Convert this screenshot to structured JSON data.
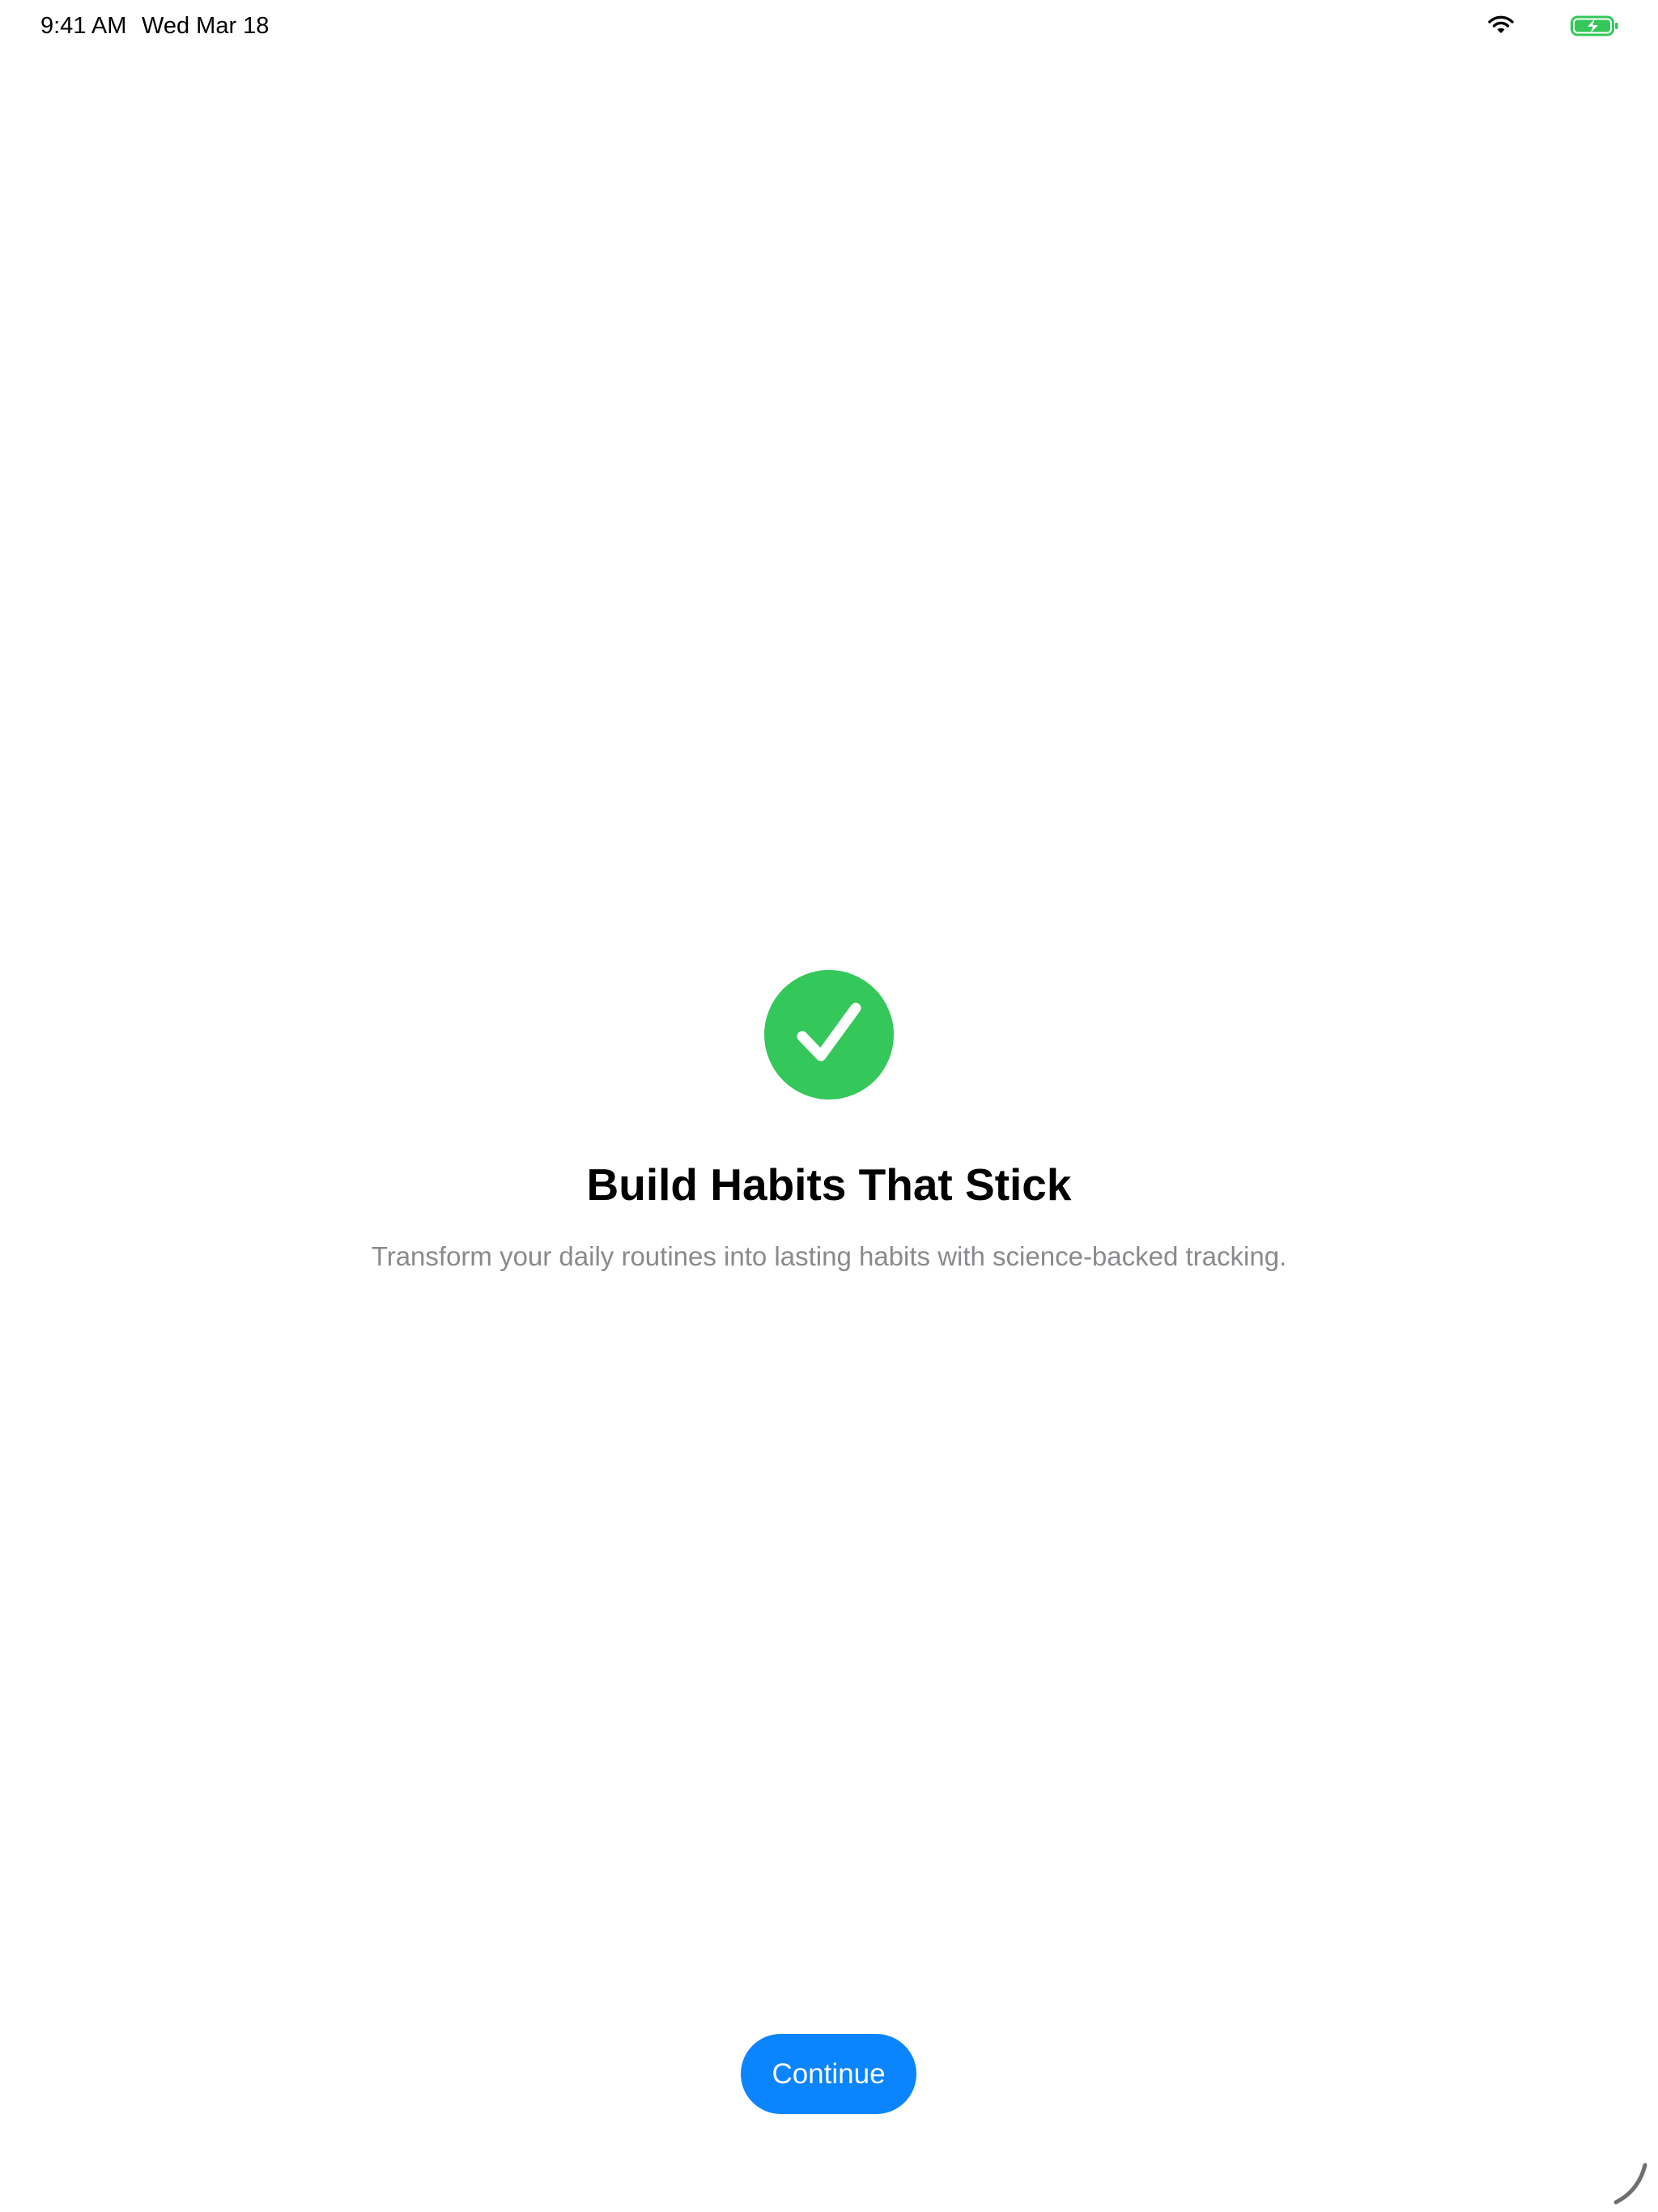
{
  "status_bar": {
    "time": "9:41 AM",
    "date": "Wed Mar 18",
    "wifi_icon": "wifi-icon",
    "battery_icon": "battery-charging-icon",
    "battery_color": "#34c759"
  },
  "onboarding": {
    "hero_icon": "checkmark-circle-icon",
    "hero_color": "#34c759",
    "title": "Build Habits That Stick",
    "subtitle": "Transform your daily routines into lasting habits with science-backed tracking.",
    "continue_label": "Continue",
    "accent_color": "#0a84ff"
  },
  "window": {
    "resize_icon": "resize-grabber-icon"
  }
}
